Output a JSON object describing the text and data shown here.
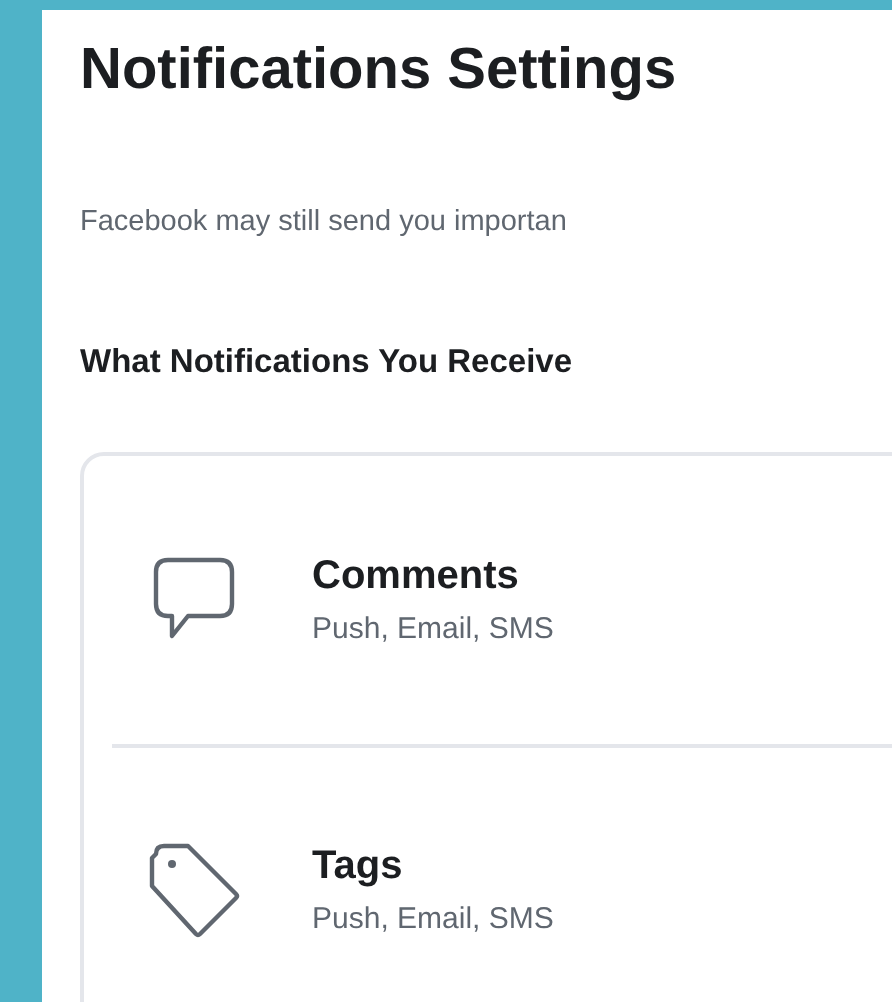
{
  "title": "Notifications Settings",
  "description": "Facebook may still send you importan",
  "section_heading": "What Notifications You Receive",
  "items": [
    {
      "kind": "comment",
      "title": "Comments",
      "channels": "Push, Email, SMS"
    },
    {
      "kind": "tag",
      "title": "Tags",
      "channels": "Push, Email, SMS"
    }
  ]
}
